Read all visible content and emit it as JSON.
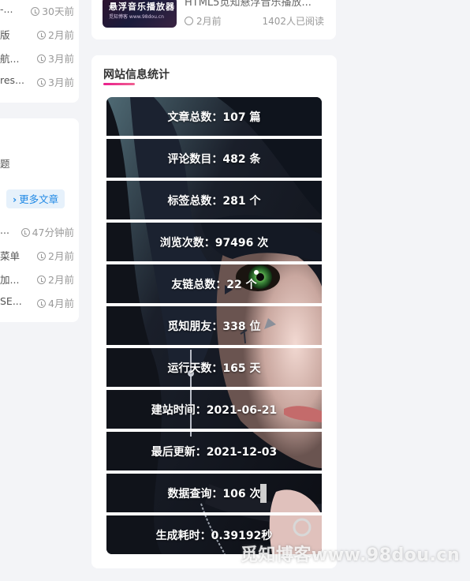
{
  "left_recent": {
    "items": [
      {
        "title": "-...",
        "time": "30天前"
      },
      {
        "title": "版",
        "time": "2月前"
      },
      {
        "title": "航...",
        "time": "3月前"
      },
      {
        "title": "res...",
        "time": "3月前"
      }
    ]
  },
  "left_posts": {
    "partial_title": "题",
    "more_button": "更多文章",
    "items": [
      {
        "title": "...",
        "time": "47分钟前"
      },
      {
        "title": "菜单",
        "time": "2月前"
      },
      {
        "title": "加...",
        "time": "2月前"
      },
      {
        "title": "SE...",
        "time": "4月前"
      }
    ]
  },
  "featured_post": {
    "thumb_title": "悬浮音乐播放器",
    "thumb_sub": "觅知博客 www.98dou.cn",
    "title": "HTML5觅知悬浮音乐播放...",
    "time": "2月前",
    "reads": "1402人已阅读"
  },
  "site_stats": {
    "heading": "网站信息统计",
    "rows": [
      {
        "label": "文章总数：107 篇"
      },
      {
        "label": "评论数目：482 条"
      },
      {
        "label": "标签总数：281 个"
      },
      {
        "label": "浏览次数：97496 次"
      },
      {
        "label": "友链总数：22 个"
      },
      {
        "label": "觅知朋友：338 位"
      },
      {
        "label": "运行天数：165 天"
      },
      {
        "label": "建站时间：2021-06-21"
      },
      {
        "label": "最后更新：2021-12-03"
      },
      {
        "label": "数据查询：106 次"
      },
      {
        "label": "生成耗时：0.39192秒"
      }
    ]
  },
  "watermark": "觅知博客www.98dou.cn",
  "colors": {
    "accent_underline": "#e91e8c",
    "more_button_text": "#1e88e5",
    "more_button_bg": "#e6f1fb",
    "page_bg": "#f3f4f7"
  }
}
